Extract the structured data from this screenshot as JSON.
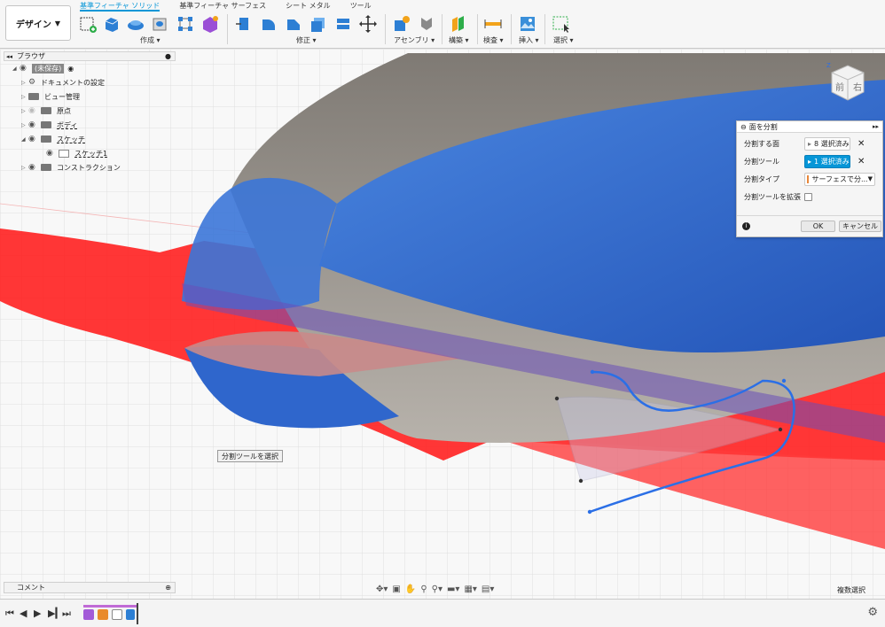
{
  "toolbar": {
    "design_label": "デザイン",
    "tabs": [
      "基準フィーチャ ソリッド",
      "基準フィーチャ サーフェス",
      "シート メタル",
      "ツール"
    ],
    "groups": {
      "create": "作成",
      "modify": "修正",
      "assemble": "アセンブリ",
      "construct": "構築",
      "inspect": "検査",
      "insert": "挿入",
      "select": "選択"
    }
  },
  "browser": {
    "title": "ブラウザ",
    "root": "(未保存)",
    "items": [
      {
        "label": "ドキュメントの設定"
      },
      {
        "label": "ビュー管理"
      },
      {
        "label": "原点"
      },
      {
        "label": "ボディ"
      },
      {
        "label": "スケッチ"
      },
      {
        "label": "スケッチ1"
      },
      {
        "label": "コンストラクション"
      }
    ]
  },
  "panel": {
    "title": "面を分割",
    "rows": {
      "faces_label": "分割する面",
      "faces_value": "8 選択済み",
      "tool_label": "分割ツール",
      "tool_value": "1 選択済み",
      "type_label": "分割タイプ",
      "type_value": "サーフェスで分...",
      "extend_label": "分割ツールを拡張"
    },
    "ok": "OK",
    "cancel": "キャンセル"
  },
  "viewcube": {
    "front": "前",
    "right": "右",
    "axis_z": "Z"
  },
  "tooltip": "分割ツールを選択",
  "comments": {
    "label": "コメント"
  },
  "status": {
    "multi_select": "複数選択"
  },
  "colors": {
    "accent": "#0696d7",
    "surface_red": "#ff1a1a",
    "body_blue": "#2f6fd6",
    "body_gray": "#9a9590"
  }
}
